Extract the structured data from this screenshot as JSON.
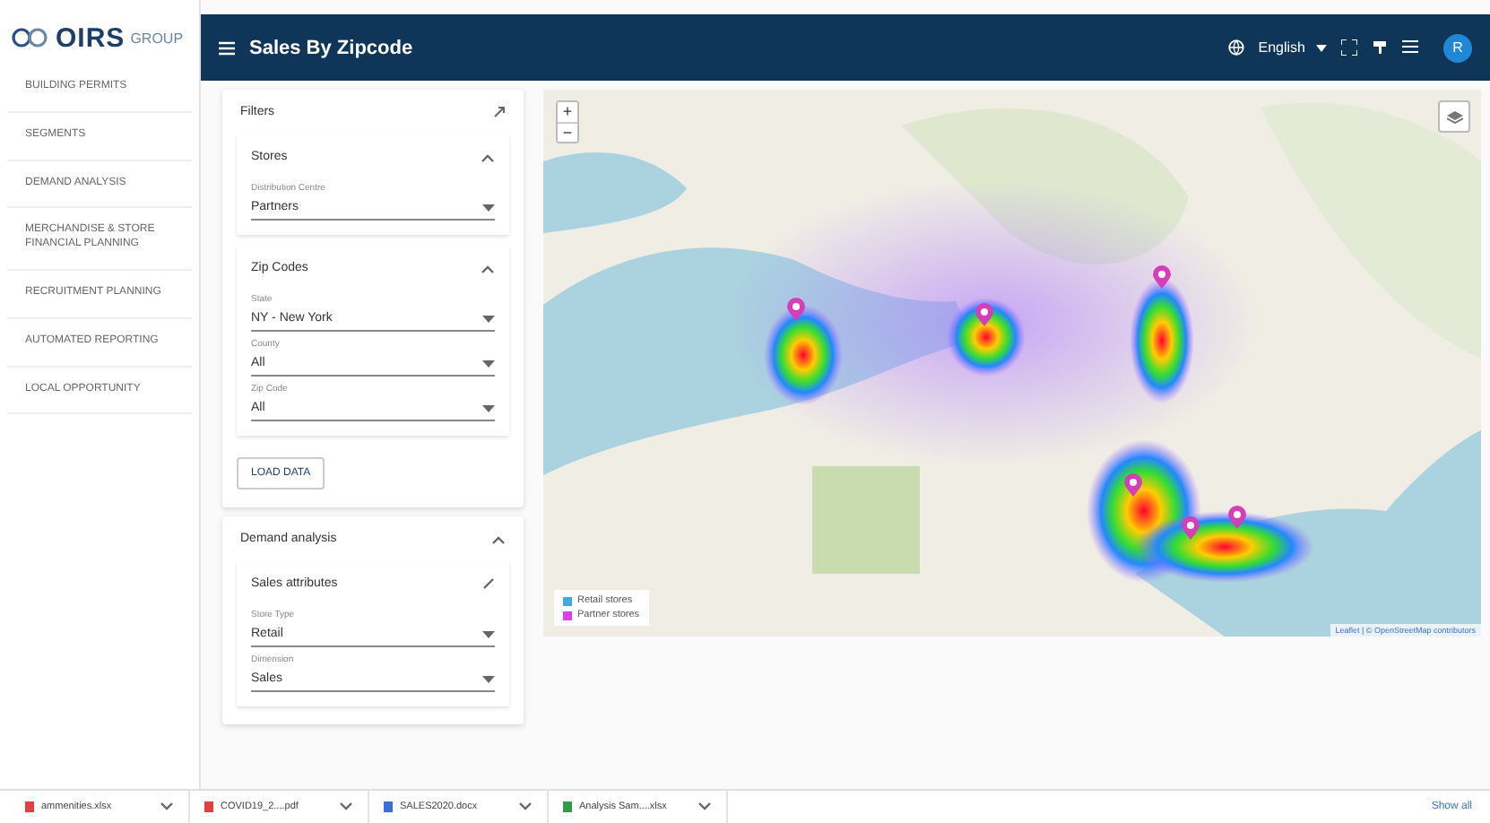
{
  "logo": {
    "name": "OIRS",
    "suffix": "GROUP"
  },
  "sidebar": {
    "items": [
      {
        "label": "BUILDING PERMITS"
      },
      {
        "label": "SEGMENTS"
      },
      {
        "label": "DEMAND ANALYSIS"
      },
      {
        "label": "MERCHANDISE & STORE FINANCIAL PLANNING"
      },
      {
        "label": "RECRUITMENT PLANNING"
      },
      {
        "label": "AUTOMATED REPORTING"
      },
      {
        "label": "LOCAL OPPORTUNITY"
      }
    ]
  },
  "header": {
    "title": "Sales By Zipcode",
    "language": "English",
    "avatar": "R"
  },
  "filters": {
    "title": "Filters",
    "sections": [
      {
        "title": "Stores",
        "expanded": true,
        "fields": [
          {
            "label": "Distribution Centre",
            "value": "Partners"
          }
        ]
      },
      {
        "title": "Zip Codes",
        "expanded": true,
        "fields": [
          {
            "label": "State",
            "value": "NY - New York"
          },
          {
            "label": "County",
            "value": "All"
          },
          {
            "label": "Zip Code",
            "value": "All"
          }
        ]
      }
    ],
    "button": "LOAD DATA"
  },
  "demand": {
    "title": "Demand analysis",
    "expanded": true,
    "section": {
      "title": "Sales attributes",
      "fields": [
        {
          "label": "Store Type",
          "value": "Retail"
        },
        {
          "label": "Dimension",
          "value": "Sales"
        }
      ]
    }
  },
  "map": {
    "zoom_in": "+",
    "zoom_out": "−",
    "legend": [
      {
        "label": "Retail stores",
        "color": "#3fa9e0"
      },
      {
        "label": "Partner stores",
        "color": "#e040e0"
      }
    ],
    "attribution": "Leaflet | © OpenStreetMap contributors"
  },
  "downloads": {
    "items": [
      {
        "name": "ammenities.xlsx",
        "color": "#e04040"
      },
      {
        "name": "COVID19_2....pdf",
        "color": "#e04040"
      },
      {
        "name": "SALES2020.docx",
        "color": "#3a6fd8"
      },
      {
        "name": "Analysis Sam....xlsx",
        "color": "#2e9e4a"
      }
    ],
    "show_all": "Show all"
  }
}
